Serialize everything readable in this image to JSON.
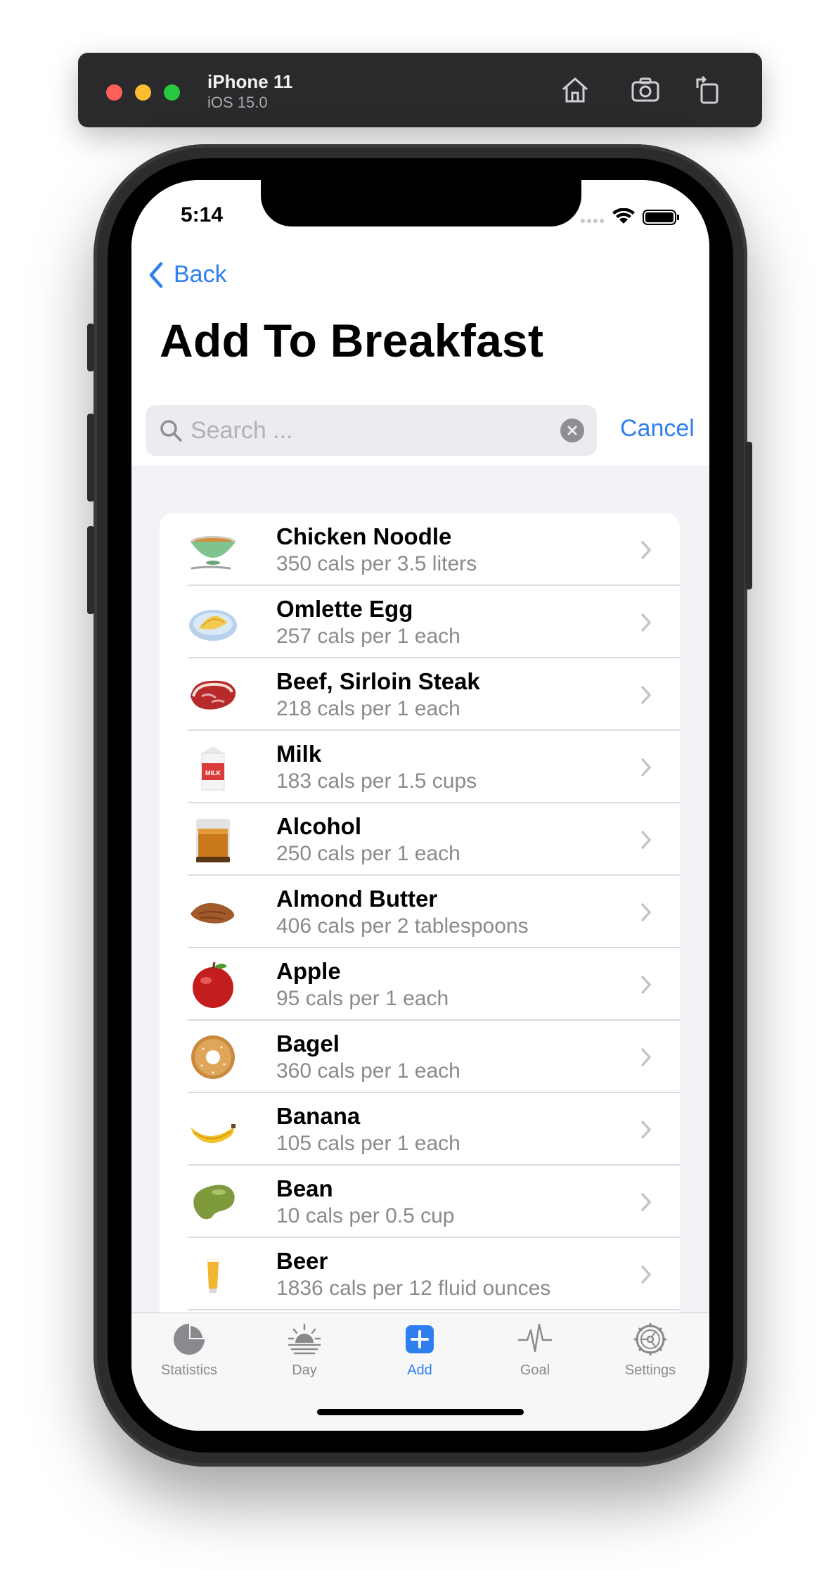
{
  "simulator": {
    "device": "iPhone 11",
    "os": "iOS 15.0",
    "buttons": [
      "home-icon",
      "screenshot-icon",
      "rotate-icon"
    ]
  },
  "status_bar": {
    "time": "5:14"
  },
  "nav": {
    "back_label": "Back",
    "title": "Add To Breakfast"
  },
  "search": {
    "placeholder": "Search ...",
    "value": "",
    "cancel_label": "Cancel"
  },
  "foods": [
    {
      "name": "Chicken Noodle",
      "detail": "350 cals per 3.5 liters",
      "icon": "soup-bowl-icon"
    },
    {
      "name": "Omlette Egg",
      "detail": "257 cals per 1 each",
      "icon": "omelette-icon"
    },
    {
      "name": "Beef, Sirloin Steak",
      "detail": "218 cals per 1 each",
      "icon": "steak-icon"
    },
    {
      "name": "Milk",
      "detail": "183 cals per 1.5 cups",
      "icon": "milk-carton-icon",
      "icon_text": "MILK"
    },
    {
      "name": "Alcohol",
      "detail": "250 cals per 1 each",
      "icon": "whiskey-glass-icon"
    },
    {
      "name": "Almond Butter",
      "detail": "406 cals per 2 tablespoons",
      "icon": "almond-icon"
    },
    {
      "name": "Apple",
      "detail": "95 cals per 1 each",
      "icon": "apple-icon"
    },
    {
      "name": "Bagel",
      "detail": "360 cals per 1 each",
      "icon": "bagel-icon"
    },
    {
      "name": "Banana",
      "detail": "105 cals per 1 each",
      "icon": "banana-icon"
    },
    {
      "name": "Bean",
      "detail": "10 cals per 0.5 cup",
      "icon": "bean-icon"
    },
    {
      "name": "Beer",
      "detail": "1836 cals per 12 fluid ounces",
      "icon": "beer-glass-icon"
    }
  ],
  "tabs": [
    {
      "label": "Statistics",
      "icon": "pie-chart-icon",
      "active": false
    },
    {
      "label": "Day",
      "icon": "sunrise-icon",
      "active": false
    },
    {
      "label": "Add",
      "icon": "plus-square-icon",
      "active": true
    },
    {
      "label": "Goal",
      "icon": "heartbeat-icon",
      "active": false
    },
    {
      "label": "Settings",
      "icon": "gear-icon",
      "active": false
    }
  ],
  "colors": {
    "accent": "#2f7ff0",
    "secondary_text": "#8a8a8e",
    "grouped_background": "#f2f2f7"
  }
}
